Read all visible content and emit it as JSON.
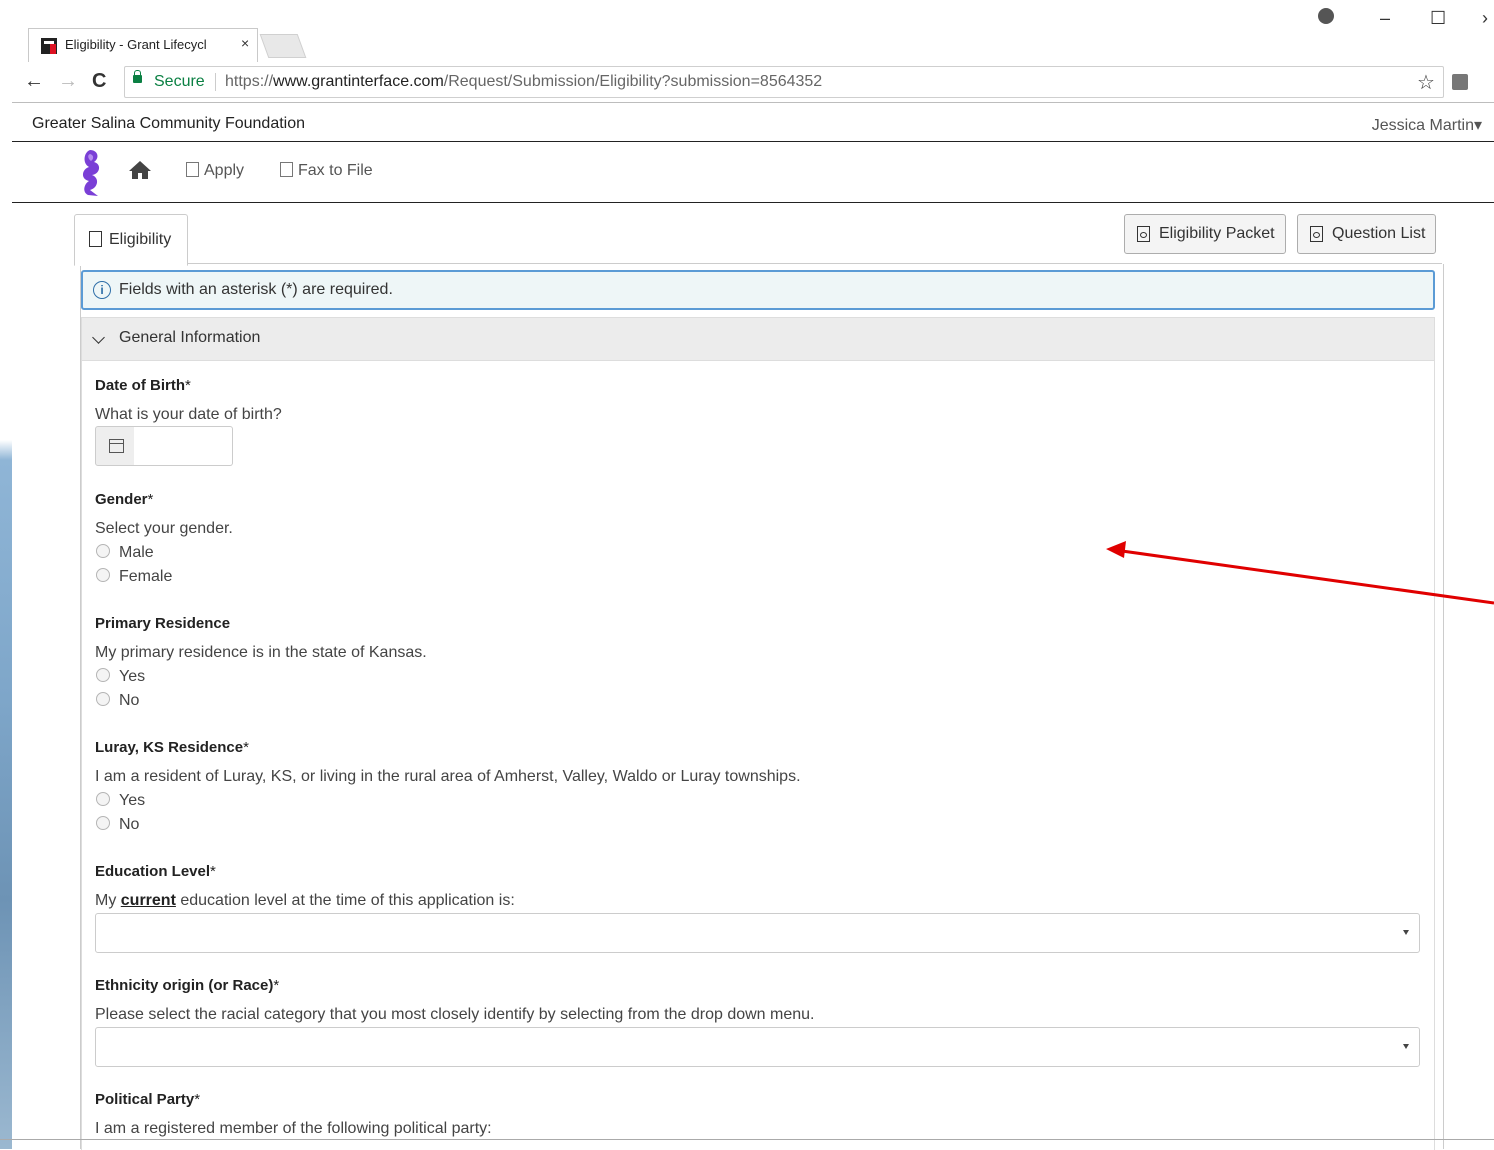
{
  "browser": {
    "tab_title": "Eligibility - Grant Lifecycl",
    "tab_close": "×",
    "secure_label": "Secure",
    "url_scheme": "https://",
    "url_host": "www.grantinterface.com",
    "url_path": "/Request/Submission/Eligibility?submission=8564352",
    "back": "←",
    "forward": "→",
    "reload": "C",
    "star": "☆",
    "minimize": "–",
    "maximize": "☐",
    "close": "›"
  },
  "header": {
    "org_name": "Greater Salina Community Foundation",
    "user_name": "Jessica Martin",
    "user_caret": "▾"
  },
  "nav": {
    "apply_label": "Apply",
    "fax_label": "Fax to File"
  },
  "tabs": {
    "eligibility_label": "Eligibility"
  },
  "buttons": {
    "eligibility_packet": "Eligibility Packet",
    "question_list": "Question List"
  },
  "info": {
    "icon": "i",
    "text": "Fields with an asterisk (*) are required."
  },
  "section": {
    "title": "General Information"
  },
  "questions": {
    "dob": {
      "label": "Date of Birth",
      "asterisk": "*",
      "help": "What is your date of birth?"
    },
    "gender": {
      "label": "Gender",
      "asterisk": "*",
      "help": "Select your gender.",
      "options": [
        "Male",
        "Female"
      ]
    },
    "residence": {
      "label": "Primary Residence",
      "help": "My primary residence is in the state of Kansas.",
      "options": [
        "Yes",
        "No"
      ]
    },
    "luray": {
      "label": "Luray, KS Residence",
      "asterisk": "*",
      "help": "I am a resident of Luray, KS, or living in the rural area of Amherst, Valley, Waldo or Luray townships.",
      "options": [
        "Yes",
        "No"
      ]
    },
    "education": {
      "label": "Education Level",
      "asterisk": "*",
      "help_pre": "My ",
      "help_bold": "current",
      "help_post": " education level at the time of this application is:",
      "value": ""
    },
    "ethnicity": {
      "label": "Ethnicity origin (or Race)",
      "asterisk": "*",
      "help": "Please select the racial category that you most closely identify by selecting from the drop down menu.",
      "value": ""
    },
    "party": {
      "label": "Political Party",
      "asterisk": "*",
      "help": "I am a registered member of the following political party:"
    }
  },
  "colors": {
    "annotation_arrow": "#e00000",
    "secure_green": "#0b8043",
    "info_border": "#5b9bd5",
    "logo_purple": "#7a3fd6"
  }
}
